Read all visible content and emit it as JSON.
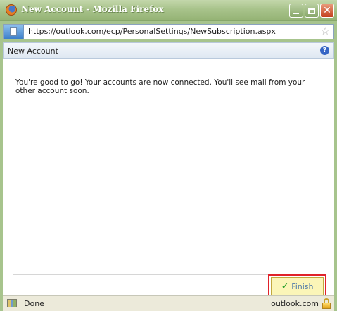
{
  "window": {
    "title": "New Account - Mozilla Firefox",
    "minimize_icon": "minimize-icon",
    "maximize_icon": "maximize-icon",
    "close_icon": "close-icon"
  },
  "address_bar": {
    "url": "https://outlook.com/ecp/PersonalSettings/NewSubscription.aspx",
    "bookmark_icon": "star-icon"
  },
  "header": {
    "title": "New Account",
    "help_icon": "help-icon"
  },
  "content": {
    "message": "You're good to go! Your accounts are now connected. You'll see mail from your other account soon."
  },
  "actions": {
    "finish_label": "Finish",
    "highlight_color": "#e0222a"
  },
  "status_bar": {
    "text": "Done",
    "domain": "outlook.com",
    "lock_icon": "lock-icon"
  }
}
